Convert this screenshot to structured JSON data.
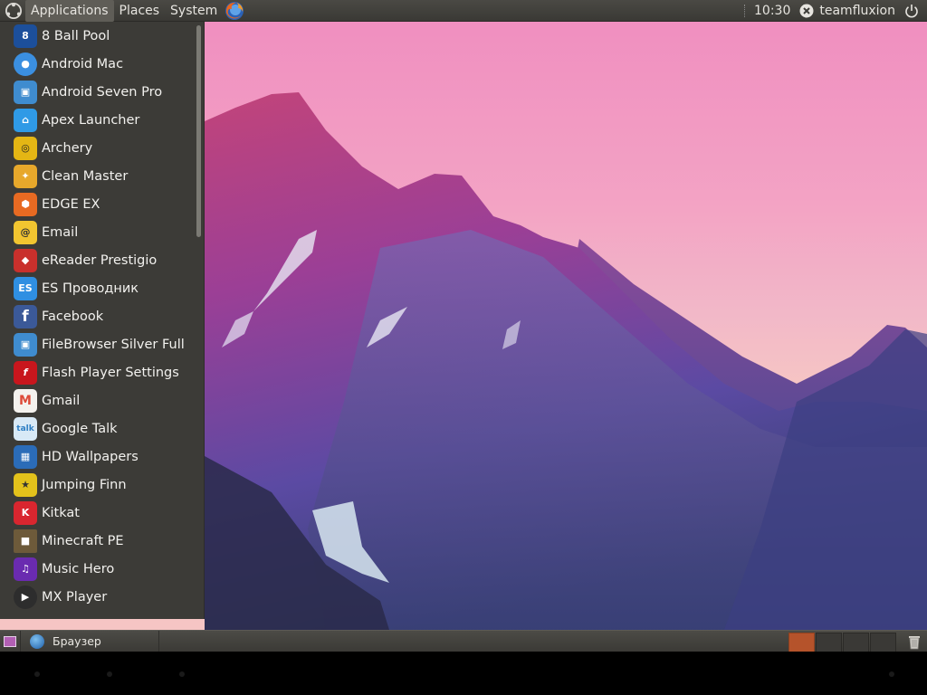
{
  "top_panel": {
    "menus": [
      {
        "label": "Applications"
      },
      {
        "label": "Places"
      },
      {
        "label": "System"
      }
    ],
    "clock": "10:30",
    "username": "teamfluxion"
  },
  "apps_menu": {
    "items": [
      {
        "label": "8 Ball Pool",
        "icon": "eight-ball-icon",
        "color": "#1c4f9b"
      },
      {
        "label": "Android Mac",
        "icon": "android-mac-icon",
        "color": "#3b8fe0"
      },
      {
        "label": "Android Seven Pro",
        "icon": "android-seven-pro-icon",
        "color": "#3f8ccf"
      },
      {
        "label": "Apex Launcher",
        "icon": "apex-launcher-icon",
        "color": "#2f9ae6"
      },
      {
        "label": "Archery",
        "icon": "archery-icon",
        "color": "#e4b614"
      },
      {
        "label": "Clean Master",
        "icon": "clean-master-icon",
        "color": "#e7a82b"
      },
      {
        "label": "EDGE EX",
        "icon": "edge-ex-icon",
        "color": "#e86a22"
      },
      {
        "label": "Email",
        "icon": "email-icon",
        "color": "#f2c530"
      },
      {
        "label": "eReader Prestigio",
        "icon": "ereader-prestigio-icon",
        "color": "#c9302c"
      },
      {
        "label": "ES Проводник",
        "icon": "es-file-explorer-icon",
        "color": "#2f8fe2"
      },
      {
        "label": "Facebook",
        "icon": "facebook-icon",
        "color": "#3b5998"
      },
      {
        "label": "FileBrowser Silver Full",
        "icon": "filebrowser-icon",
        "color": "#3f8ccf"
      },
      {
        "label": "Flash Player Settings",
        "icon": "flash-player-icon",
        "color": "#c8161d"
      },
      {
        "label": "Gmail",
        "icon": "gmail-icon",
        "color": "#dd4b39"
      },
      {
        "label": "Google Talk",
        "icon": "google-talk-icon",
        "color": "#5ba4d9"
      },
      {
        "label": "HD Wallpapers",
        "icon": "hd-wallpapers-icon",
        "color": "#2b6cb8"
      },
      {
        "label": "Jumping Finn",
        "icon": "jumping-finn-icon",
        "color": "#e3c21b"
      },
      {
        "label": "Kitkat",
        "icon": "kitkat-icon",
        "color": "#d9262f"
      },
      {
        "label": "Minecraft PE",
        "icon": "minecraft-pe-icon",
        "color": "#6d5a3a"
      },
      {
        "label": "Music Hero",
        "icon": "music-hero-icon",
        "color": "#6a2bb0"
      },
      {
        "label": "MX Player",
        "icon": "mx-player-icon",
        "color": "#2d2d2d"
      }
    ]
  },
  "bottom_panel": {
    "task_label": "Браузер",
    "workspaces": 4,
    "active_workspace": 1
  }
}
